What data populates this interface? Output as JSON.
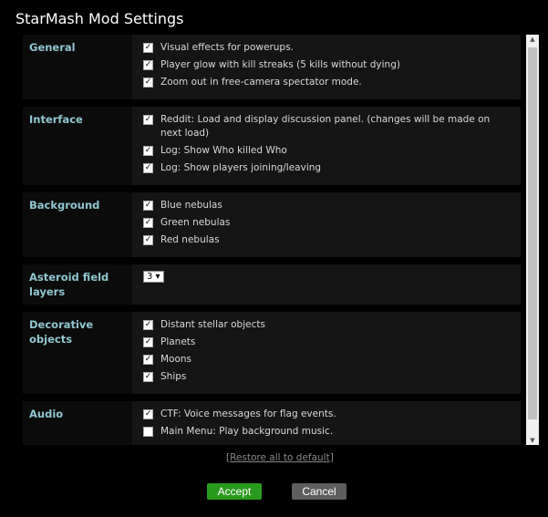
{
  "title": "StarMash Mod Settings",
  "sections": [
    {
      "label": "General",
      "options": [
        {
          "text": "Visual effects for powerups.",
          "checked": true
        },
        {
          "text": "Player glow with kill streaks (5 kills without dying)",
          "checked": true
        },
        {
          "text": "Zoom out in free-camera spectator mode.",
          "checked": true
        }
      ]
    },
    {
      "label": "Interface",
      "options": [
        {
          "text": "Reddit: Load and display discussion panel. (changes will be made on next load)",
          "checked": true
        },
        {
          "text": "Log: Show Who killed Who",
          "checked": true
        },
        {
          "text": "Log: Show players joining/leaving",
          "checked": true
        }
      ]
    },
    {
      "label": "Background",
      "options": [
        {
          "text": "Blue nebulas",
          "checked": true
        },
        {
          "text": "Green nebulas",
          "checked": true
        },
        {
          "text": "Red nebulas",
          "checked": true
        }
      ]
    },
    {
      "label": "Asteroid field layers",
      "select": "3"
    },
    {
      "label": "Decorative objects",
      "options": [
        {
          "text": "Distant stellar objects",
          "checked": true
        },
        {
          "text": "Planets",
          "checked": true
        },
        {
          "text": "Moons",
          "checked": true
        },
        {
          "text": "Ships",
          "checked": true
        }
      ]
    },
    {
      "label": "Audio",
      "options": [
        {
          "text": "CTF: Voice messages for flag events.",
          "checked": true
        },
        {
          "text": "Main Menu: Play background music.",
          "checked": false
        }
      ]
    }
  ],
  "restore": {
    "open": "[",
    "label": "Restore all to default",
    "close": "]"
  },
  "buttons": {
    "accept": "Accept",
    "cancel": "Cancel"
  },
  "colors": {
    "accept": "#2a9a1f",
    "cancel": "#5e5e5e",
    "section_label": "#8fc7d0"
  }
}
